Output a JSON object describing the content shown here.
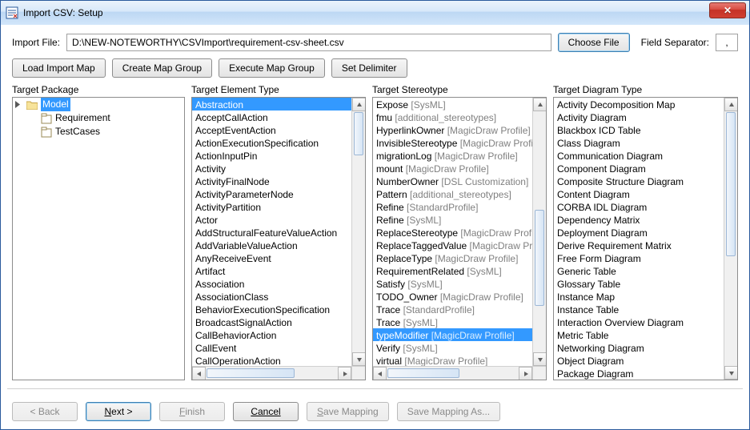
{
  "window": {
    "title": "Import CSV: Setup"
  },
  "importFile": {
    "label": "Import File:",
    "path": "D:\\NEW-NOTEWORTHY\\CSVImport\\requirement-csv-sheet.csv",
    "chooseBtn": "Choose File"
  },
  "fieldSeparator": {
    "label": "Field Separator:",
    "value": ","
  },
  "toolbar": {
    "loadMap": "Load Import Map",
    "createGroup": "Create Map Group",
    "executeGroup": "Execute Map Group",
    "setDelimiter": "Set Delimiter"
  },
  "columns": {
    "pkgLabel": "Target Package",
    "etypeLabel": "Target Element Type",
    "stereoLabel": "Target Stereotype",
    "diagLabel": "Target Diagram Type"
  },
  "tree": {
    "root": {
      "label": "Model",
      "selected": true
    },
    "children": [
      {
        "label": "Requirement"
      },
      {
        "label": "TestCases"
      }
    ]
  },
  "elementTypes": {
    "selectedIndex": 0,
    "items": [
      "Abstraction",
      "AcceptCallAction",
      "AcceptEventAction",
      "ActionExecutionSpecification",
      "ActionInputPin",
      "Activity",
      "ActivityFinalNode",
      "ActivityParameterNode",
      "ActivityPartition",
      "Actor",
      "AddStructuralFeatureValueAction",
      "AddVariableValueAction",
      "AnyReceiveEvent",
      "Artifact",
      "Association",
      "AssociationClass",
      "BehaviorExecutionSpecification",
      "BroadcastSignalAction",
      "CallBehaviorAction",
      "CallEvent",
      "CallOperationAction"
    ]
  },
  "stereotypes": {
    "selectedIndex": 18,
    "items": [
      {
        "name": "Expose",
        "profile": "SysML"
      },
      {
        "name": "fmu",
        "profile": "additional_stereotypes"
      },
      {
        "name": "HyperlinkOwner",
        "profile": "MagicDraw Profile"
      },
      {
        "name": "InvisibleStereotype",
        "profile": "MagicDraw Profile"
      },
      {
        "name": "migrationLog",
        "profile": "MagicDraw Profile"
      },
      {
        "name": "mount",
        "profile": "MagicDraw Profile"
      },
      {
        "name": "NumberOwner",
        "profile": "DSL Customization"
      },
      {
        "name": "Pattern",
        "profile": "additional_stereotypes"
      },
      {
        "name": "Refine",
        "profile": "StandardProfile"
      },
      {
        "name": "Refine",
        "profile": "SysML"
      },
      {
        "name": "ReplaceStereotype",
        "profile": "MagicDraw Profile"
      },
      {
        "name": "ReplaceTaggedValue",
        "profile": "MagicDraw Profile"
      },
      {
        "name": "ReplaceType",
        "profile": "MagicDraw Profile"
      },
      {
        "name": "RequirementRelated",
        "profile": "SysML"
      },
      {
        "name": "Satisfy",
        "profile": "SysML"
      },
      {
        "name": "TODO_Owner",
        "profile": "MagicDraw Profile"
      },
      {
        "name": "Trace",
        "profile": "StandardProfile"
      },
      {
        "name": "Trace",
        "profile": "SysML"
      },
      {
        "name": "typeModifier",
        "profile": "MagicDraw Profile"
      },
      {
        "name": "Verify",
        "profile": "SysML"
      },
      {
        "name": "virtual",
        "profile": "MagicDraw Profile"
      }
    ]
  },
  "diagramTypes": {
    "items": [
      "Activity Decomposition Map",
      "Activity Diagram",
      "Blackbox ICD Table",
      "Class Diagram",
      "Communication Diagram",
      "Component Diagram",
      "Composite Structure Diagram",
      "Content Diagram",
      "CORBA IDL Diagram",
      "Dependency Matrix",
      "Deployment Diagram",
      "Derive Requirement Matrix",
      "Free Form Diagram",
      "Generic Table",
      "Glossary Table",
      "Instance Map",
      "Instance Table",
      "Interaction Overview Diagram",
      "Metric Table",
      "Networking Diagram",
      "Object Diagram",
      "Package Diagram"
    ]
  },
  "footer": {
    "back": "Back",
    "next": "Next >",
    "finish": "Finish",
    "cancel": "Cancel",
    "saveMapping": "Save Mapping",
    "saveMappingAs": "Save Mapping As..."
  }
}
